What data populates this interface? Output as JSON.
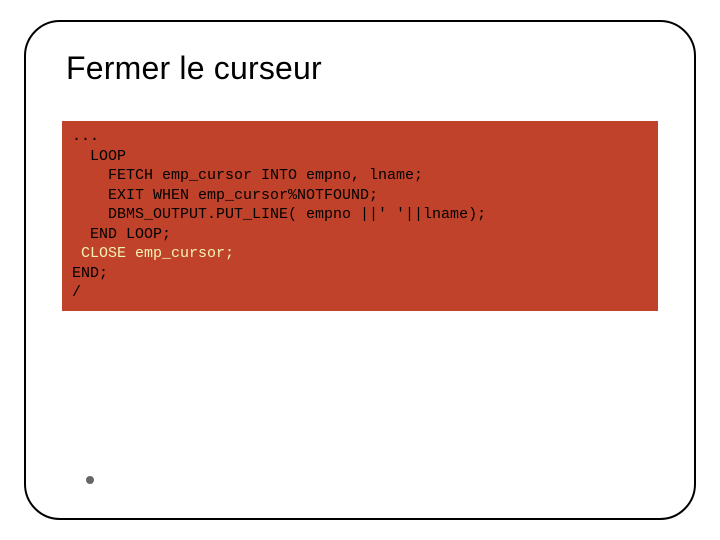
{
  "slide": {
    "title": "Fermer le curseur",
    "code": {
      "l1": "...",
      "l2": "  LOOP",
      "l3": "    FETCH emp_cursor INTO empno, lname;",
      "l4": "    EXIT WHEN emp_cursor%NOTFOUND;",
      "l5": "    DBMS_OUTPUT.PUT_LINE( empno ||' '||lname);",
      "l6": "  END LOOP;",
      "l7": " CLOSE emp_cursor;",
      "l8": "END;",
      "l9": "/"
    }
  }
}
